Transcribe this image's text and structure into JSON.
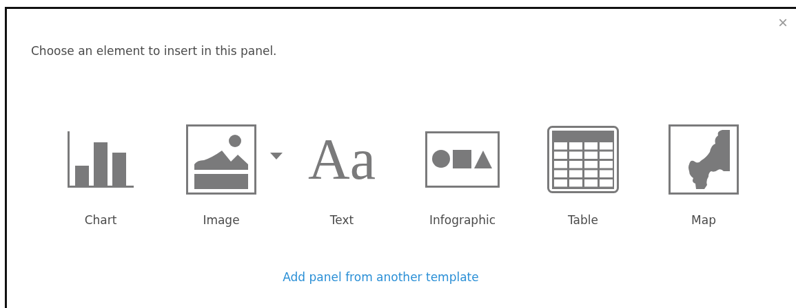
{
  "dialog": {
    "prompt": "Choose an element to insert in this panel.",
    "close": "×",
    "elements": [
      {
        "kind": "chart",
        "label": "Chart",
        "has_dropdown": false
      },
      {
        "kind": "image",
        "label": "Image",
        "has_dropdown": true
      },
      {
        "kind": "text",
        "label": "Text",
        "glyph": "Aa",
        "has_dropdown": false
      },
      {
        "kind": "infographic",
        "label": "Infographic",
        "has_dropdown": false
      },
      {
        "kind": "table",
        "label": "Table",
        "has_dropdown": false
      },
      {
        "kind": "map",
        "label": "Map",
        "has_dropdown": false
      }
    ],
    "link": "Add panel from another template"
  }
}
